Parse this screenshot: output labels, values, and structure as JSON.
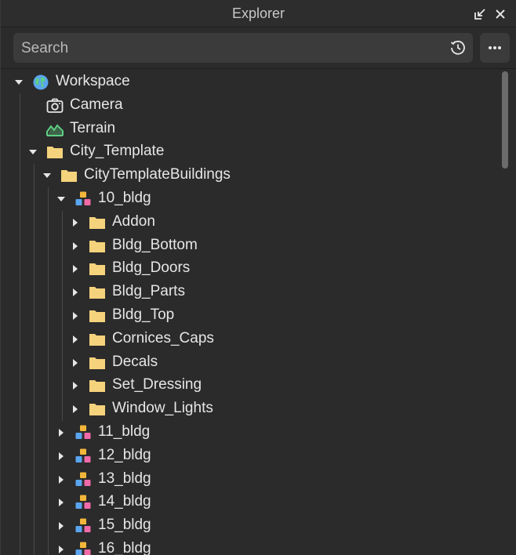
{
  "window": {
    "title": "Explorer"
  },
  "search": {
    "placeholder": "Search",
    "value": ""
  },
  "tree": [
    {
      "label": "Workspace",
      "depth": 0,
      "icon": "globe-icon",
      "state": "expanded"
    },
    {
      "label": "Camera",
      "depth": 1,
      "icon": "camera-icon",
      "state": "none"
    },
    {
      "label": "Terrain",
      "depth": 1,
      "icon": "terrain-icon",
      "state": "none"
    },
    {
      "label": "City_Template",
      "depth": 1,
      "icon": "folder-icon",
      "state": "expanded"
    },
    {
      "label": "CityTemplateBuildings",
      "depth": 2,
      "icon": "folder-icon",
      "state": "expanded"
    },
    {
      "label": "10_bldg",
      "depth": 3,
      "icon": "model-icon",
      "state": "expanded"
    },
    {
      "label": "Addon",
      "depth": 4,
      "icon": "folder-icon",
      "state": "collapsed"
    },
    {
      "label": "Bldg_Bottom",
      "depth": 4,
      "icon": "folder-icon",
      "state": "collapsed"
    },
    {
      "label": "Bldg_Doors",
      "depth": 4,
      "icon": "folder-icon",
      "state": "collapsed"
    },
    {
      "label": "Bldg_Parts",
      "depth": 4,
      "icon": "folder-icon",
      "state": "collapsed"
    },
    {
      "label": "Bldg_Top",
      "depth": 4,
      "icon": "folder-icon",
      "state": "collapsed"
    },
    {
      "label": "Cornices_Caps",
      "depth": 4,
      "icon": "folder-icon",
      "state": "collapsed"
    },
    {
      "label": "Decals",
      "depth": 4,
      "icon": "folder-icon",
      "state": "collapsed"
    },
    {
      "label": "Set_Dressing",
      "depth": 4,
      "icon": "folder-icon",
      "state": "collapsed"
    },
    {
      "label": "Window_Lights",
      "depth": 4,
      "icon": "folder-icon",
      "state": "collapsed"
    },
    {
      "label": "11_bldg",
      "depth": 3,
      "icon": "model-icon",
      "state": "collapsed"
    },
    {
      "label": "12_bldg",
      "depth": 3,
      "icon": "model-icon",
      "state": "collapsed"
    },
    {
      "label": "13_bldg",
      "depth": 3,
      "icon": "model-icon",
      "state": "collapsed"
    },
    {
      "label": "14_bldg",
      "depth": 3,
      "icon": "model-icon",
      "state": "collapsed"
    },
    {
      "label": "15_bldg",
      "depth": 3,
      "icon": "model-icon",
      "state": "collapsed"
    },
    {
      "label": "16_bldg",
      "depth": 3,
      "icon": "model-icon",
      "state": "collapsed"
    }
  ],
  "colors": {
    "background": "#2b2b2b",
    "folder": "#f5d27c",
    "terrain": "#5fcf84",
    "model_yellow": "#f2b63a",
    "model_blue": "#5aa5f0",
    "model_pink": "#f06aa8"
  }
}
